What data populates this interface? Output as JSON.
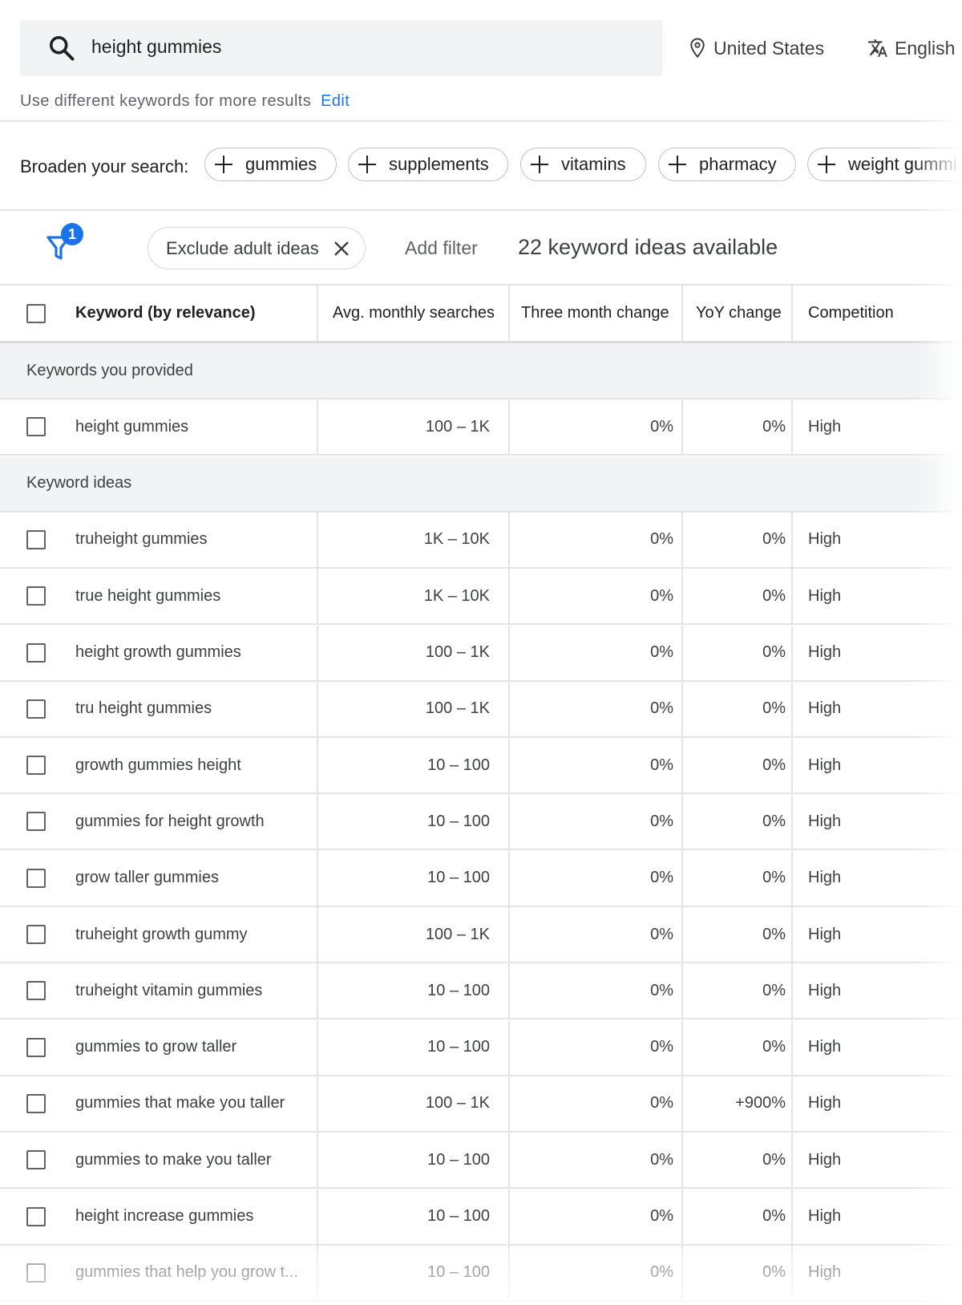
{
  "search": {
    "query": "height gummies"
  },
  "location": "United States",
  "language": "English",
  "hint": {
    "text": "Use different keywords for more results",
    "edit": "Edit"
  },
  "broaden": {
    "label": "Broaden your search:",
    "chips": [
      "gummies",
      "supplements",
      "vitamins",
      "pharmacy",
      "weight gummi"
    ]
  },
  "filters": {
    "badge": "1",
    "pill": "Exclude adult ideas",
    "add_filter": "Add filter",
    "available": "22 keyword ideas available"
  },
  "table": {
    "headers": {
      "keyword": "Keyword (by relevance)",
      "avg": "Avg. monthly searches",
      "three": "Three month change",
      "yoy": "YoY change",
      "competition": "Competition"
    },
    "provided_label": "Keywords you provided",
    "provided": [
      {
        "keyword": "height gummies",
        "avg": "100 – 1K",
        "three": "0%",
        "yoy": "0%",
        "competition": "High"
      }
    ],
    "ideas_label": "Keyword ideas",
    "ideas": [
      {
        "keyword": "truheight gummies",
        "avg": "1K – 10K",
        "three": "0%",
        "yoy": "0%",
        "competition": "High"
      },
      {
        "keyword": "true height gummies",
        "avg": "1K – 10K",
        "three": "0%",
        "yoy": "0%",
        "competition": "High"
      },
      {
        "keyword": "height growth gummies",
        "avg": "100 – 1K",
        "three": "0%",
        "yoy": "0%",
        "competition": "High"
      },
      {
        "keyword": "tru height gummies",
        "avg": "100 – 1K",
        "three": "0%",
        "yoy": "0%",
        "competition": "High"
      },
      {
        "keyword": "growth gummies height",
        "avg": "10 – 100",
        "three": "0%",
        "yoy": "0%",
        "competition": "High"
      },
      {
        "keyword": "gummies for height growth",
        "avg": "10 – 100",
        "three": "0%",
        "yoy": "0%",
        "competition": "High"
      },
      {
        "keyword": "grow taller gummies",
        "avg": "10 – 100",
        "three": "0%",
        "yoy": "0%",
        "competition": "High"
      },
      {
        "keyword": "truheight growth gummy",
        "avg": "100 – 1K",
        "three": "0%",
        "yoy": "0%",
        "competition": "High"
      },
      {
        "keyword": "truheight vitamin gummies",
        "avg": "10 – 100",
        "three": "0%",
        "yoy": "0%",
        "competition": "High"
      },
      {
        "keyword": "gummies to grow taller",
        "avg": "10 – 100",
        "three": "0%",
        "yoy": "0%",
        "competition": "High"
      },
      {
        "keyword": "gummies that make you taller",
        "avg": "100 – 1K",
        "three": "0%",
        "yoy": "+900%",
        "competition": "High"
      },
      {
        "keyword": "gummies to make you taller",
        "avg": "10 – 100",
        "three": "0%",
        "yoy": "0%",
        "competition": "High"
      },
      {
        "keyword": "height increase gummies",
        "avg": "10 – 100",
        "three": "0%",
        "yoy": "0%",
        "competition": "High"
      },
      {
        "keyword": "gummies that help you grow t...",
        "avg": "10 – 100",
        "three": "0%",
        "yoy": "0%",
        "competition": "High"
      }
    ]
  },
  "colors": {
    "accent": "#1a73e8",
    "searchbar_bg": "#f1f3f4",
    "group_bg": "#f1f3f4"
  }
}
